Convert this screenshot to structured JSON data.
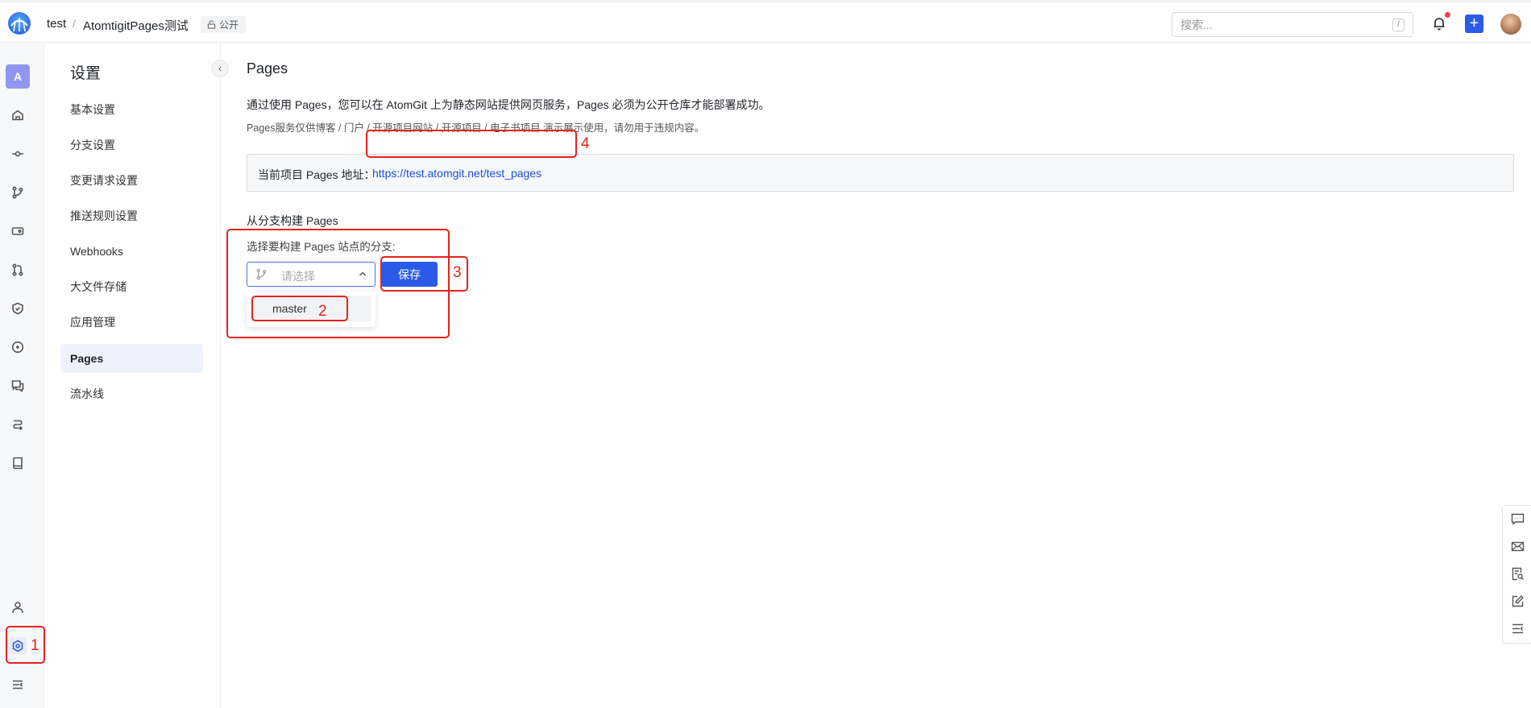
{
  "header": {
    "owner": "test",
    "separator": "/",
    "repo": "AtomtigitPages测试",
    "visibility": "公开",
    "search_placeholder": "搜索...",
    "search_shortcut": "/",
    "plus_label": "+"
  },
  "iconrail": {
    "project_initial": "A"
  },
  "settings_nav": {
    "title": "设置",
    "collapse_glyph": "‹",
    "items": [
      {
        "label": "基本设置"
      },
      {
        "label": "分支设置"
      },
      {
        "label": "变更请求设置"
      },
      {
        "label": "推送规则设置"
      },
      {
        "label": "Webhooks"
      },
      {
        "label": "大文件存储"
      },
      {
        "label": "应用管理"
      },
      {
        "label": "Pages",
        "active": true
      },
      {
        "label": "流水线"
      }
    ]
  },
  "main": {
    "title": "Pages",
    "description": "通过使用 Pages，您可以在 AtomGit 上为静态网站提供网页服务，Pages 必须为公开仓库才能部署成功。",
    "notice": "Pages服务仅供博客 / 门户 / 开源项目网站 / 开源项目 / 电子书项目 演示展示使用，请勿用于违规内容。",
    "url_label": "当前项目 Pages 地址：",
    "url": "https://test.atomgit.net/test_pages",
    "build_section_title": "从分支构建 Pages",
    "branch_prompt": "选择要构建 Pages 站点的分支:",
    "select_placeholder": "请选择",
    "save_label": "保存",
    "branch_options": [
      "master"
    ]
  },
  "annotations": {
    "n1": "1",
    "n2": "2",
    "n3": "3",
    "n4": "4",
    "color": "#e6231c"
  },
  "colors": {
    "primary": "#2b5be6",
    "link": "#1a4fe0",
    "active_nav_bg": "#eef2fd",
    "project_avatar": "#8f97f2"
  }
}
